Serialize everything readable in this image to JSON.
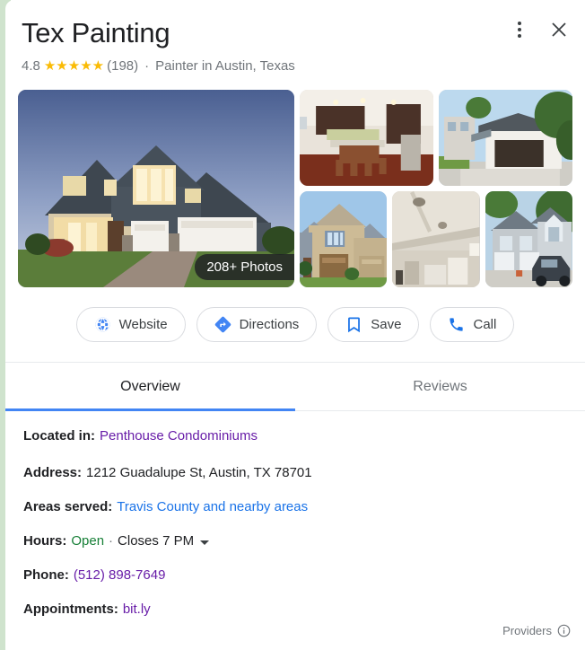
{
  "business": {
    "name": "Tex Painting",
    "rating": "4.8",
    "stars": "★★★★★",
    "review_count": "(198)",
    "separator": "·",
    "category": "Painter in Austin, Texas"
  },
  "header_icons": {
    "overflow_label": "More options",
    "close_label": "Close"
  },
  "photos": {
    "badge": "208+ Photos",
    "hero_alt": "Two-story craftsman house at twilight with lit windows and white garage doors",
    "thumbnails": [
      {
        "alt": "Kitchen and dining room interior with dark wood cabinets and hardwood floor"
      },
      {
        "alt": "White modern house with dark brown garage door and driveway"
      },
      {
        "alt": "Tan two-story duplex with brown garage door"
      },
      {
        "alt": "Interior ceiling and wall being prepped for painting"
      },
      {
        "alt": "Gray two-story house with white garage doors and parked pickup truck"
      }
    ]
  },
  "actions": [
    {
      "icon": "globe-icon",
      "label": "Website"
    },
    {
      "icon": "directions-icon",
      "label": "Directions"
    },
    {
      "icon": "bookmark-icon",
      "label": "Save"
    },
    {
      "icon": "phone-icon",
      "label": "Call"
    }
  ],
  "tabs": [
    {
      "label": "Overview",
      "active": true
    },
    {
      "label": "Reviews",
      "active": false
    }
  ],
  "details": {
    "located_in": {
      "label": "Located in:",
      "value": "Penthouse Condominiums"
    },
    "address": {
      "label": "Address:",
      "value": "1212 Guadalupe St, Austin, TX 78701"
    },
    "areas_served": {
      "label": "Areas served:",
      "value": "Travis County and nearby areas"
    },
    "hours": {
      "label": "Hours:",
      "status": "Open",
      "separator": "·",
      "closing": "Closes 7 PM"
    },
    "phone": {
      "label": "Phone:",
      "value": "(512) 898-7649"
    },
    "appointments": {
      "label": "Appointments:",
      "value": "bit.ly"
    }
  },
  "footer": {
    "providers_label": "Providers",
    "info_icon": "info-icon"
  },
  "colors": {
    "accent_blue": "#4285f4",
    "link_blue": "#1a73e8",
    "visited_purple": "#681da8",
    "open_green": "#188038",
    "star_gold": "#fabb05"
  }
}
